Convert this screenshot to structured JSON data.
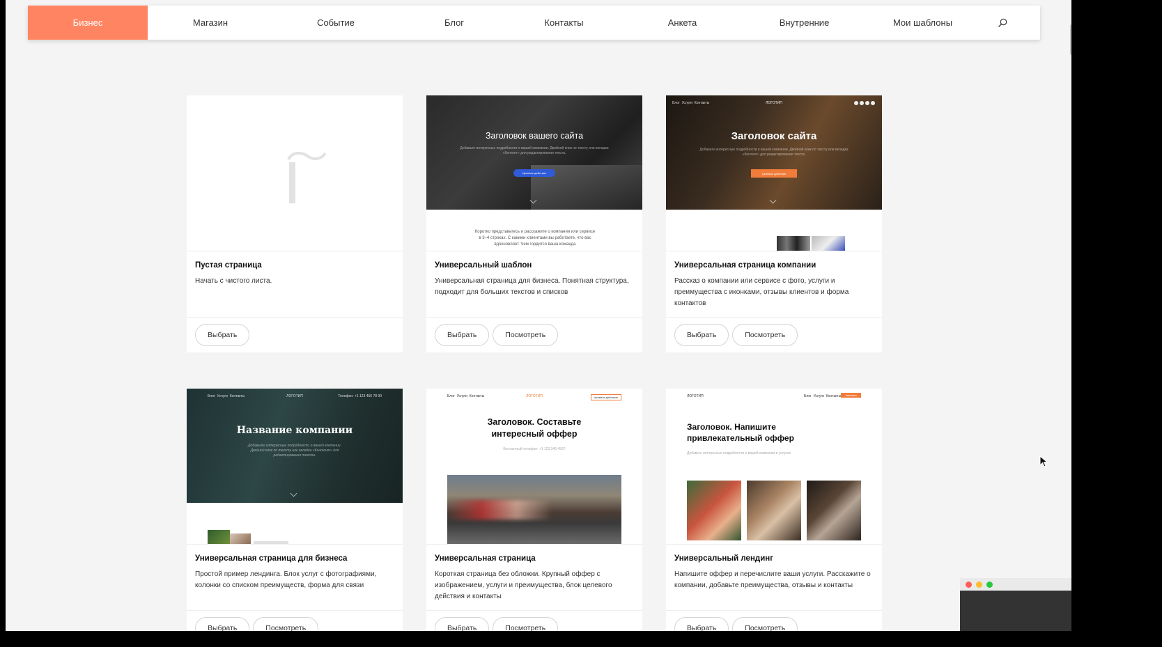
{
  "nav": {
    "items": [
      {
        "label": "Бизнес",
        "active": true
      },
      {
        "label": "Магазин"
      },
      {
        "label": "Событие"
      },
      {
        "label": "Блог"
      },
      {
        "label": "Контакты"
      },
      {
        "label": "Анкета"
      },
      {
        "label": "Внутренние"
      },
      {
        "label": "Мои шаблоны"
      }
    ],
    "search_icon": "search-icon"
  },
  "cards": [
    {
      "title": "Пустая страница",
      "description": "Начать с чистого листа.",
      "buttons": [
        "Выбрать"
      ]
    },
    {
      "title": "Универсальный шаблон",
      "description": "Универсальная страница для бизнеса. Понятная структура, подходит для больших текстов и списков",
      "buttons": [
        "Выбрать",
        "Посмотреть"
      ],
      "preview": {
        "hero_title": "Заголовок вашего сайта",
        "hero_sub": "Добавьте интересные подробности о вашей компании. Двойной клик по тексту или вкладка «Контент» для редактирования текста.",
        "cta": "Целевое действие",
        "body_text": "Коротко представьтесь и расскажите о компании или сервисе в 3–4 строках. С какими клиентами вы работаете, что вас вдохновляет. Чем гордится ваша команда"
      }
    },
    {
      "title": "Универсальная страница компании",
      "description": "Рассказ о компании или сервисе с фото, услуги и преимущества с иконками, отзывы клиентов и форма контактов",
      "buttons": [
        "Выбрать",
        "Посмотреть"
      ],
      "preview": {
        "nav": [
          "Блог",
          "Услуги",
          "Контакты"
        ],
        "logo": "ЛОГОТИП",
        "hero_title": "Заголовок сайта",
        "hero_sub": "Добавьте интересные подробности о вашей компании. Двойной клик по тексту или вкладка «Контент» для редактирования текста.",
        "cta": "Целевое действие"
      }
    },
    {
      "title": "Универсальная страница для бизнеса",
      "description": "Простой пример лендинга. Блок услуг с фотографиями, колонки со списком преимуществ, форма для связи",
      "buttons": [
        "Выбрать",
        "Посмотреть"
      ],
      "preview": {
        "nav": [
          "Блог",
          "Услуги",
          "Контакты"
        ],
        "logo": "ЛОГОТИП",
        "phone": "Телефон: +1 123 456 78 90",
        "hero_title": "Название компании",
        "hero_sub": "Добавьте интересные подробности о вашей компании. Двойной клик по тексту или вкладка «Контент» для редактирования текста."
      }
    },
    {
      "title": "Универсальная страница",
      "description": "Короткая страница без обложки. Крупный оффер с изображением, услуги и преимущества, блок целевого действия и контакты",
      "buttons": [
        "Выбрать",
        "Посмотреть"
      ],
      "preview": {
        "nav": [
          "Блог",
          "Услуги",
          "Контакты"
        ],
        "logo": "ЛОГОТИП",
        "cta": "Целевое действие",
        "hero_title": "Заголовок. Составьте интересный оффер",
        "phone": "Контактный телефон: +1 123 345 4567"
      }
    },
    {
      "title": "Универсальный лендинг",
      "description": "Напишите оффер и перечислите ваши услуги. Расскажите о компании, добавьте преимущества, отзывы и контакты",
      "buttons": [
        "Выбрать",
        "Посмотреть"
      ],
      "preview": {
        "logo": "ЛОГОТИП",
        "nav": [
          "Блог",
          "Услуги",
          "Контакты"
        ],
        "cta": "Заказать",
        "hero_title": "Заголовок. Напишите привлекательный оффер",
        "hero_sub": "Добавьте интересные подробности о вашей компании и услугах"
      }
    }
  ],
  "colors": {
    "accent": "#ff8562",
    "cta_blue": "#2f5bd8",
    "cta_orange": "#f07c3a",
    "dark_green": "#23393a"
  }
}
